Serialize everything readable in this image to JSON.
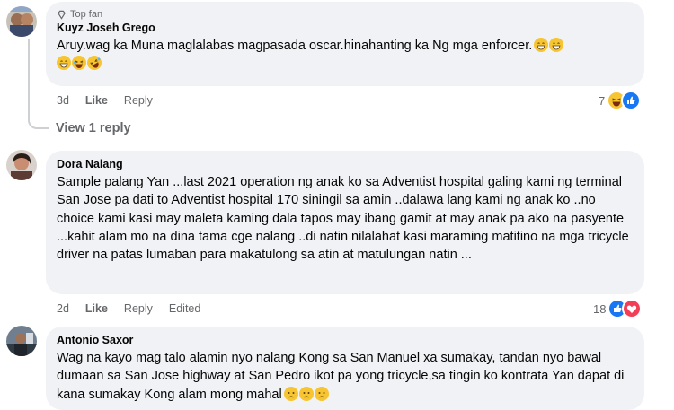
{
  "comments": [
    {
      "badge": "Top fan",
      "author": "Kuyz Joseh Grego",
      "text": "Aruy.wag ka Muna maglalabas magpasada oscar.hinahanting ka Ng mga enforcer.",
      "time": "3d",
      "like": "Like",
      "reply": "Reply",
      "reaction_count": "7",
      "reactions": [
        "haha-icon",
        "like-icon"
      ],
      "emojis": [
        "grin-emoji",
        "grin-emoji",
        "grin-emoji",
        "laugh-emoji",
        "rofl-emoji"
      ]
    },
    {
      "author": "Dora Nalang",
      "text": "Sample palang Yan ...last 2021 operation ng anak ko sa Adventist hospital galing kami ng terminal San Jose pa dati to Adventist hospital 170 siningil sa amin ..dalawa lang kami ng anak ko ..no choice kami kasi may maleta kaming dala tapos may ibang gamit at may anak pa ako na pasyente ...kahit alam mo na dina tama cge nalang ..di natin nilalahat kasi maraming matitino na mga tricycle driver na patas lumaban para makatulong sa atin at matulungan natin ...",
      "time": "2d",
      "like": "Like",
      "reply": "Reply",
      "edited": "Edited",
      "reaction_count": "18",
      "reactions": [
        "like-icon",
        "heart-icon"
      ]
    },
    {
      "author": "Antonio Saxor",
      "text": "Wag na kayo mag talo alamin nyo nalang Kong sa San Manuel xa sumakay, tandan nyo bawal dumaan sa San Jose highway at San Pedro ikot pa yong tricycle,sa tingin ko kontrata Yan dapat di kana sumakay Kong alam mong mahal",
      "emojis": [
        "sad-emoji",
        "sad-emoji",
        "sad-emoji"
      ]
    }
  ],
  "view_replies": "View 1 reply",
  "colors": {
    "bubble": "#f0f2f5",
    "meta": "#65676b",
    "like_blue": "#1877f2",
    "heart_red": "#f33e58",
    "emoji_yellow": "#f7c531"
  }
}
